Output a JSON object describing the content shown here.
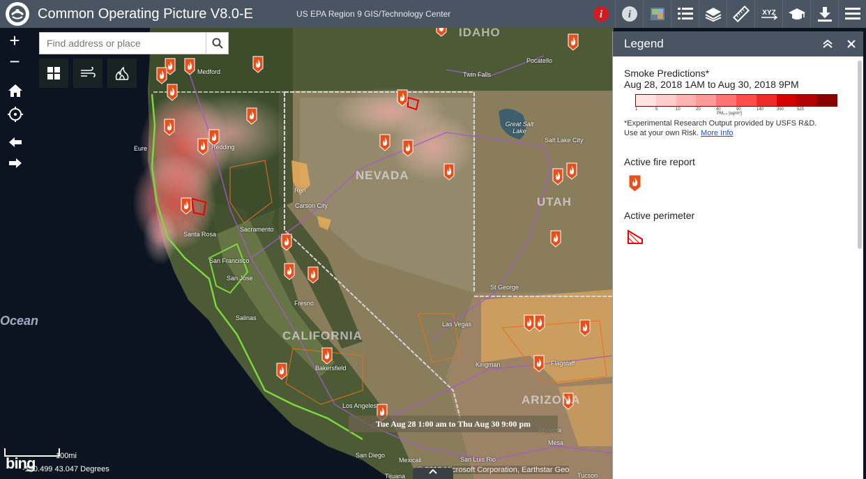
{
  "header": {
    "title": "Common Operating Picture V8.0-E",
    "subtitle": "US EPA Region 9 GIS/Technology Center",
    "tools": [
      {
        "name": "about-widget",
        "icon": "info-red-icon"
      },
      {
        "name": "about",
        "icon": "info-icon"
      },
      {
        "name": "basemap-gallery",
        "icon": "basemap-icon"
      },
      {
        "name": "layer-list",
        "icon": "list-icon"
      },
      {
        "name": "layers",
        "icon": "layers-icon"
      },
      {
        "name": "measure",
        "icon": "ruler-icon"
      },
      {
        "name": "coordinates",
        "icon": "xyz-icon"
      },
      {
        "name": "education",
        "icon": "graduation-cap-icon"
      },
      {
        "name": "download",
        "icon": "download-icon"
      },
      {
        "name": "menu",
        "icon": "menu-icon"
      }
    ],
    "xyz_label": "XYZ"
  },
  "search": {
    "placeholder": "Find address or place"
  },
  "zoom": {
    "in": "+",
    "out": "−"
  },
  "legend": {
    "title": "Legend",
    "smoke_title": "Smoke Predictions*",
    "smoke_dates": "Aug 28, 2018 1AM to Aug 30, 2018 9PM",
    "scale_ticks": [
      "1",
      "5",
      "10",
      "20",
      "40",
      "90",
      "140",
      "350",
      "525"
    ],
    "scale_unit": "PM₂.₅ [ug/m³]",
    "scale_colors": [
      "#ffe3e3",
      "#ffcccc",
      "#ffb3b3",
      "#ff9999",
      "#ff7373",
      "#ff4d4d",
      "#f02a2a",
      "#d40000",
      "#b30000",
      "#8a0000"
    ],
    "note_line1": "*Experimental Research Output provided by USFS R&D.",
    "note_line2": "Use at your own Risk.",
    "note_link": "More Info",
    "fire_label": "Active fire report",
    "perimeter_label": "Active perimeter"
  },
  "map": {
    "time_banner": "Tue Aug 28 1:00 am to Thu Aug 30 9:00 pm",
    "scale_label": "100mi",
    "coordinates": "-120.499 43.047 Degrees",
    "attribution": "© 2018 Microsoft Corporation, Earthstar Geo",
    "bing": "bing",
    "labels": {
      "idaho": "IDAHO",
      "nevada": "NEVADA",
      "utah": "UTAH",
      "california": "CALIFORNIA",
      "arizona": "ARIZONA",
      "ocean": "Ocean",
      "medford": "Medford",
      "twin_falls": "Twin Falls",
      "pocatello": "Pocatello",
      "great_salt_lake": "Great Salt Lake",
      "salt_lake_city": "Salt Lake City",
      "redding": "Redding",
      "eureka": "Eure",
      "reno": "Ren",
      "carson_city": "Carson City",
      "santa_rosa": "Santa Rosa",
      "sacramento": "Sacramento",
      "san_francisco": "San Francisco",
      "san_jose": "San Jose",
      "fresno": "Fresno",
      "salinas": "Salinas",
      "st_george": "St George",
      "las_vegas": "Las Vegas",
      "kingman": "Kingman",
      "flagstaff": "Flagstaff",
      "bakersfield": "Bakersfield",
      "los_angeles": "Los Angeles",
      "san_diego": "San Diego",
      "mexicali": "Mexicali",
      "san_luis_rio": "San Luis Rio",
      "phoenix": "Phoenix",
      "mesa": "Mesa",
      "tijuana": "Tijuana",
      "tucson": "Tucson"
    }
  }
}
